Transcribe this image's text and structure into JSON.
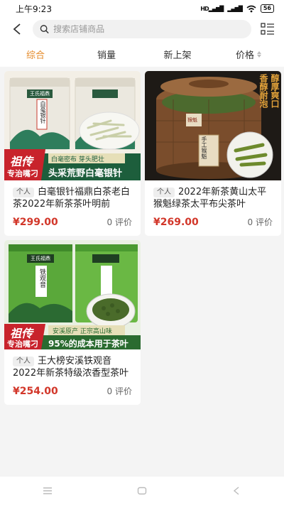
{
  "status": {
    "time": "上午9:23",
    "network": "HD",
    "battery": "56"
  },
  "search": {
    "placeholder": "搜索店铺商品"
  },
  "sort": {
    "items": [
      "综合",
      "销量",
      "新上架",
      "价格"
    ],
    "active": "综合"
  },
  "products": [
    {
      "tag": "个人",
      "title": "白毫银针福鼎白茶老白茶2022年新茶茶叶明前",
      "price": "¥299.00",
      "reviews": "0 评价",
      "image": {
        "brand": "王氏福鼎",
        "can_label": "白毫银针",
        "badge_top": "祖传",
        "badge_bottom": "专治嘴刁",
        "banner_small": "白毫密布 芽头肥壮",
        "banner_big": "头采荒野白毫银针"
      }
    },
    {
      "tag": "个人",
      "title": "2022年新茶黄山太平猴魁绿茶太平布尖茶叶",
      "price": "¥269.00",
      "reviews": "0 评价",
      "image": {
        "slogan_left": "香醇耐泡",
        "slogan_right": "醇厚爽口",
        "box_label": "手工猴魁",
        "box_brand": "猴魁"
      }
    },
    {
      "tag": "个人",
      "title": "王大榜安溪铁观音2022年新茶特级浓香型茶叶",
      "price": "¥254.00",
      "reviews": "0 评价",
      "image": {
        "brand": "王氏福鼎",
        "can_label": "铁观音",
        "badge_top": "祖传",
        "badge_bottom": "专治嘴刁",
        "banner_small": "安溪原产 正宗高山味",
        "banner_big": "95%的成本用于茶叶"
      }
    }
  ]
}
